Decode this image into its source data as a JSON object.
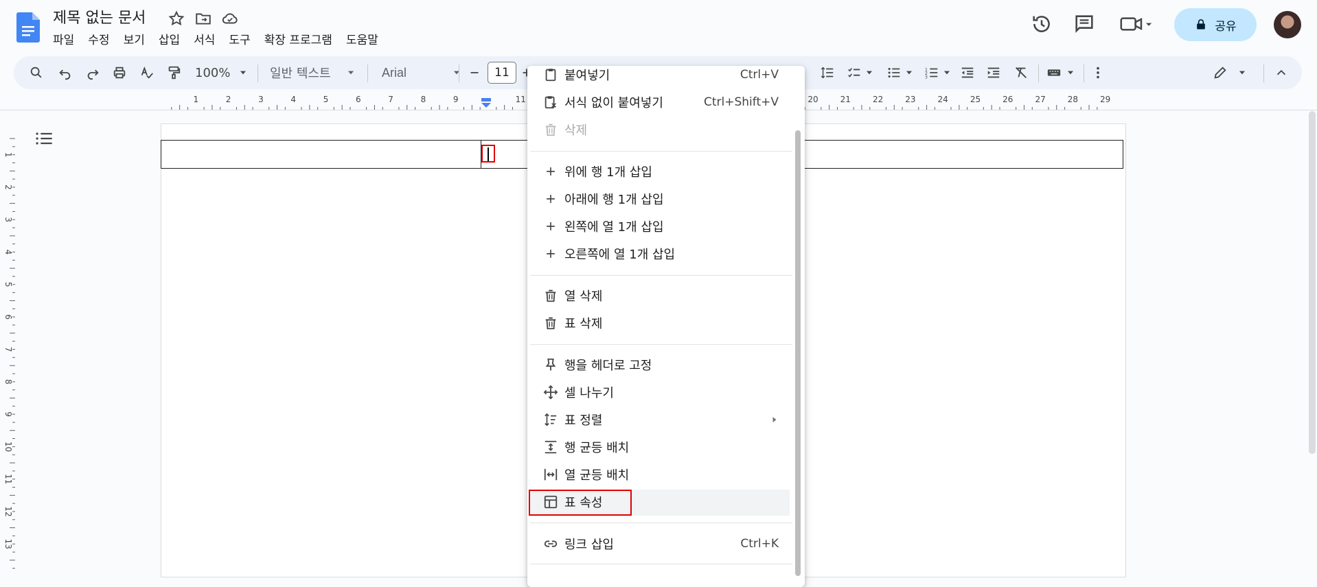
{
  "title_bar": {
    "doc_title": "제목 없는 문서",
    "share_label": "공유"
  },
  "menubar": [
    "파일",
    "수정",
    "보기",
    "삽입",
    "서식",
    "도구",
    "확장 프로그램",
    "도움말"
  ],
  "toolbar": {
    "zoom": "100%",
    "style": "일반 텍스트",
    "font": "Arial",
    "font_size": "11"
  },
  "ruler": {
    "labels": [
      "1",
      "2",
      "3",
      "4",
      "5",
      "6",
      "7",
      "8",
      "9",
      "11",
      "20",
      "21",
      "22",
      "23",
      "24",
      "25",
      "26",
      "27",
      "28",
      "29"
    ],
    "vertical_labels": [
      "1",
      "2",
      "3",
      "4",
      "5",
      "6",
      "7",
      "8",
      "9",
      "10",
      "11",
      "12",
      "13"
    ]
  },
  "context_menu": {
    "items": [
      {
        "icon": "clipboard-icon",
        "label": "붙여넣기",
        "shortcut": "Ctrl+V"
      },
      {
        "icon": "clipboard-format-icon",
        "label": "서식 없이 붙여넣기",
        "shortcut": "Ctrl+Shift+V"
      },
      {
        "icon": "trash-icon",
        "label": "삭제",
        "shortcut": "",
        "disabled": true
      },
      {
        "icon": "plus-icon",
        "label": "위에 행 1개 삽입",
        "shortcut": ""
      },
      {
        "icon": "plus-icon",
        "label": "아래에 행 1개 삽입",
        "shortcut": ""
      },
      {
        "icon": "plus-icon",
        "label": "왼쪽에 열 1개 삽입",
        "shortcut": ""
      },
      {
        "icon": "plus-icon",
        "label": "오른쪽에 열 1개 삽입",
        "shortcut": ""
      },
      {
        "icon": "trash-icon",
        "label": "열 삭제",
        "shortcut": ""
      },
      {
        "icon": "trash-icon",
        "label": "표 삭제",
        "shortcut": ""
      },
      {
        "icon": "pin-icon",
        "label": "행을 헤더로 고정",
        "shortcut": ""
      },
      {
        "icon": "split-cell-icon",
        "label": "셀 나누기",
        "shortcut": ""
      },
      {
        "icon": "sort-icon",
        "label": "표 정렬",
        "shortcut": ""
      },
      {
        "icon": "distribute-rows-icon",
        "label": "행 균등 배치",
        "shortcut": ""
      },
      {
        "icon": "distribute-columns-icon",
        "label": "열 균등 배치",
        "shortcut": ""
      },
      {
        "icon": "table-icon",
        "label": "표 속성",
        "shortcut": ""
      },
      {
        "icon": "link-icon",
        "label": "링크 삽입",
        "shortcut": "Ctrl+K"
      }
    ]
  },
  "colors": {
    "accent": "#0b57d0",
    "share_bg": "#c2e7ff",
    "highlight_red": "#e00000"
  }
}
